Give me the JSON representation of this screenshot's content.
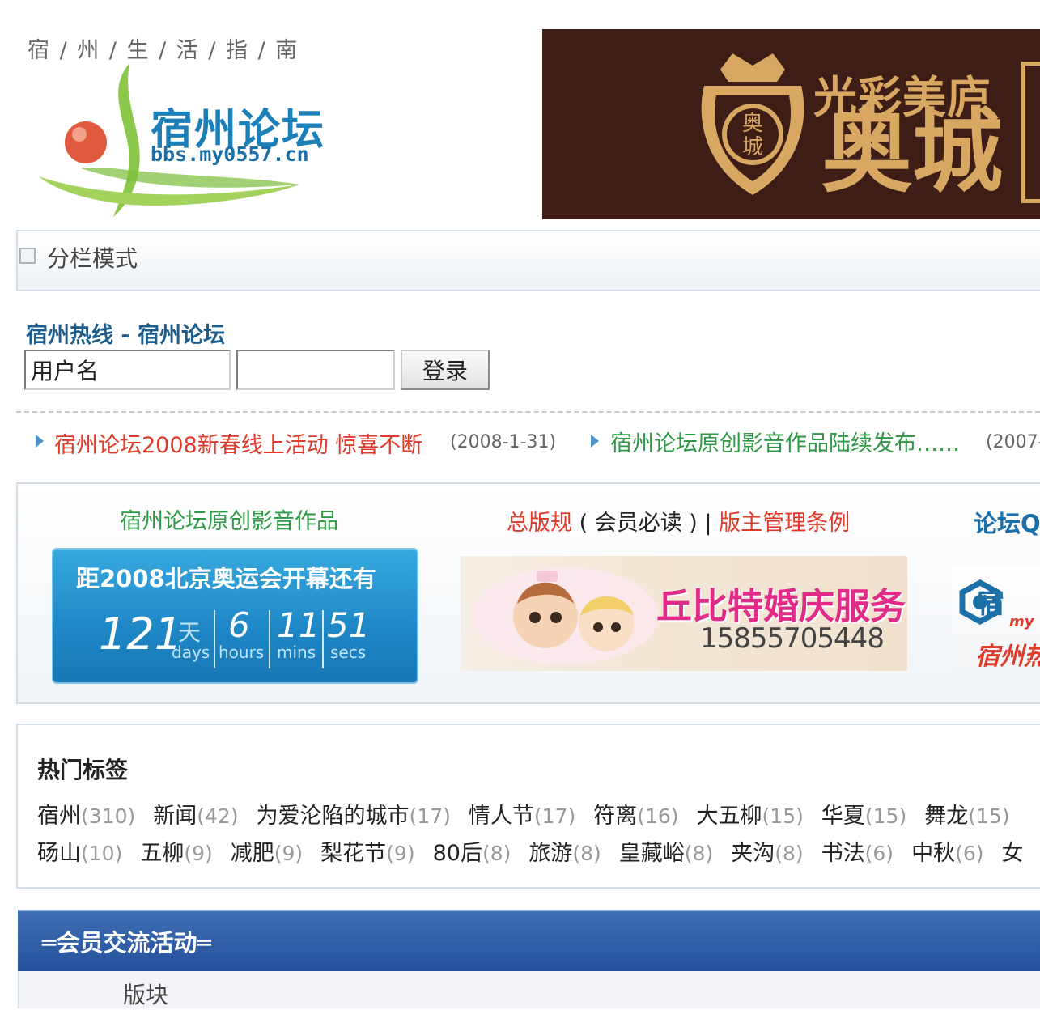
{
  "header": {
    "tagline": "宿 / 州 / 生 / 活 / 指 / 南",
    "logo_title": "宿州论坛",
    "logo_url": "bbs.my0557.cn",
    "banner_line1": "光彩美庐",
    "banner_line2": "奥城",
    "banner_crest_text": "奥城"
  },
  "column_mode": {
    "label": "分栏模式"
  },
  "login": {
    "title": "宿州热线 - 宿州论坛",
    "username_value": "用户名",
    "password_value": "",
    "submit_label": "登录"
  },
  "announcements": [
    {
      "text": "宿州论坛2008新春线上活动 惊喜不断",
      "date": "(2008-1-31)",
      "color": "#e03a2a"
    },
    {
      "text": "宿州论坛原创影音作品陆续发布……",
      "date": "(2007-",
      "color": "#2f9a45"
    }
  ],
  "feature": {
    "col1_title": "宿州论坛原创影音作品",
    "col2_rules": "总版规",
    "col2_note": "( 会员必读 )",
    "col2_sep": "|",
    "col2_manage": "版主管理条例",
    "col3_title": "论坛Q",
    "countdown": {
      "title": "距2008北京奥运会开幕还有",
      "days": "121",
      "days_cn": "天",
      "days_label": "days",
      "hours": "6",
      "hours_label": "hours",
      "mins": "11",
      "mins_label": "mins",
      "secs": "51",
      "secs_label": "secs"
    },
    "wedding_ad": {
      "title": "丘比特婚庆服务",
      "phone": "15855705448"
    },
    "qq_ad": {
      "name": "宿",
      "sub": "my",
      "bottom": "宿州热"
    }
  },
  "hot_tags": {
    "title": "热门标签",
    "row1": [
      {
        "name": "宿州",
        "count": "(310)"
      },
      {
        "name": "新闻",
        "count": "(42)"
      },
      {
        "name": "为爱沦陷的城市",
        "count": "(17)"
      },
      {
        "name": "情人节",
        "count": "(17)"
      },
      {
        "name": "符离",
        "count": "(16)"
      },
      {
        "name": "大五柳",
        "count": "(15)"
      },
      {
        "name": "华夏",
        "count": "(15)"
      },
      {
        "name": "舞龙",
        "count": "(15)"
      }
    ],
    "row2": [
      {
        "name": "砀山",
        "count": "(10)"
      },
      {
        "name": "五柳",
        "count": "(9)"
      },
      {
        "name": "减肥",
        "count": "(9)"
      },
      {
        "name": "梨花节",
        "count": "(9)"
      },
      {
        "name": "80后",
        "count": "(8)"
      },
      {
        "name": "旅游",
        "count": "(8)"
      },
      {
        "name": "皇藏峪",
        "count": "(8)"
      },
      {
        "name": "夹沟",
        "count": "(8)"
      },
      {
        "name": "书法",
        "count": "(6)"
      },
      {
        "name": "中秋",
        "count": "(6)"
      },
      {
        "name": "女",
        "count": ""
      }
    ]
  },
  "section": {
    "title": "═会员交流活动═",
    "column_header": "版块"
  }
}
